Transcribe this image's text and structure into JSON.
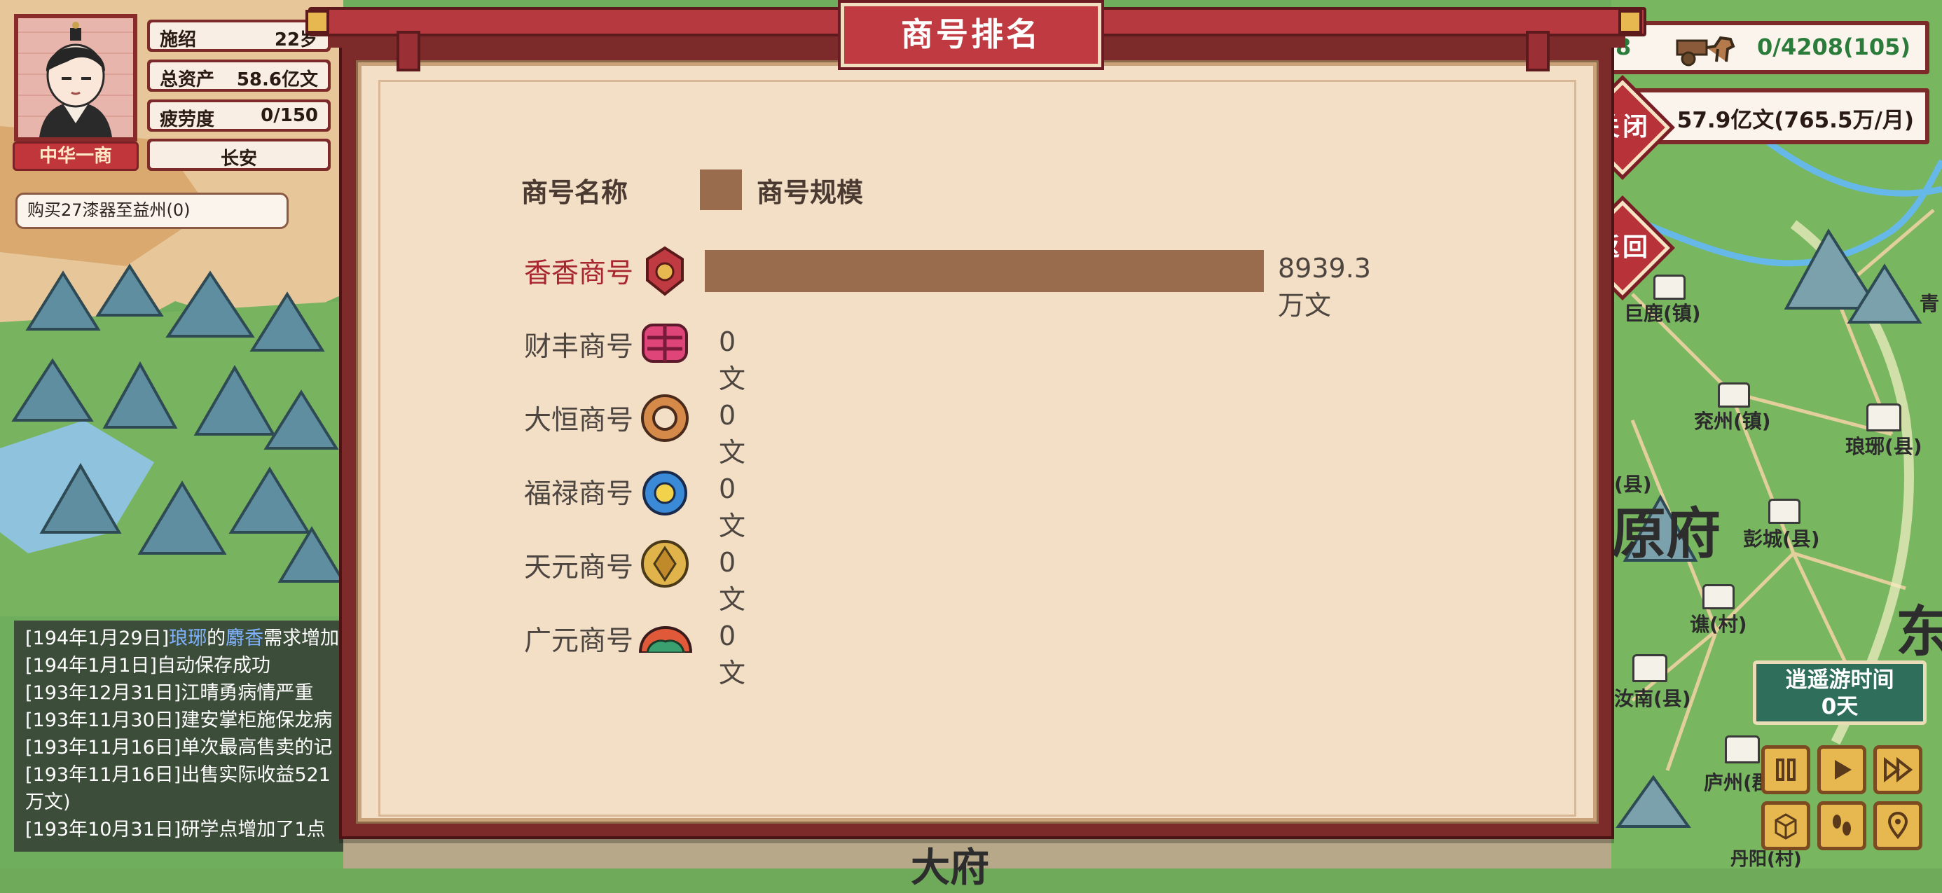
{
  "player": {
    "stats": [
      {
        "label": "施绍",
        "value": "22岁"
      },
      {
        "label": "总资产",
        "value": "58.6亿文"
      },
      {
        "label": "疲劳度",
        "value": "0/150"
      }
    ],
    "location": "长安",
    "title_badge": "中华一商",
    "task": "购买27漆器至益州(0)"
  },
  "log": [
    {
      "date": "[194年1月29日]",
      "parts": [
        "琅琊",
        "的",
        "麝香",
        "需求增加"
      ]
    },
    {
      "text": "[194年1月1日]自动保存成功"
    },
    {
      "text": "[193年12月31日]江晴勇病情严重"
    },
    {
      "text": "[193年11月30日]建安掌柜施保龙病"
    },
    {
      "text": "[193年11月16日]单次最高售卖的记"
    },
    {
      "text": "[193年11月16日]出售实际收益521"
    },
    {
      "text": "万文)"
    },
    {
      "text": "[193年10月31日]研学点增加了1点"
    }
  ],
  "top_right": {
    "cart_count": "0/4208(105)",
    "income": "57.9亿文(765.5万/月)",
    "partial_left": "8"
  },
  "buttons": {
    "close": "关闭",
    "back": "返回"
  },
  "dialog": {
    "title": "商号排名",
    "header_name": "商号名称",
    "header_scale": "商号规模",
    "legend_color": "#9a6c4e"
  },
  "chart_data": {
    "type": "bar",
    "orientation": "horizontal",
    "categories": [
      "香香商号",
      "财丰商号",
      "大恒商号",
      "福禄商号",
      "天元商号",
      "广元商号"
    ],
    "values": [
      8939.3,
      0,
      0,
      0,
      0,
      0
    ],
    "value_labels": [
      "8939.3万文",
      "0文",
      "0文",
      "0文",
      "0文",
      "0文"
    ],
    "unit": "万文",
    "xlim": [
      0,
      8939.3
    ],
    "highlight_category": "香香商号",
    "highlight_color": "#a8262e",
    "bar_color": "#9a6c4e"
  },
  "rank_icons": [
    "banner-emblem-icon",
    "ribbon-knot-icon",
    "copper-ring-icon",
    "blue-gem-icon",
    "golden-coin-icon",
    "mountain-cloud-icon"
  ],
  "time_panel": {
    "label": "逍遥游时间",
    "value": "0天"
  },
  "map_labels": [
    {
      "text": "巨鹿(镇)"
    },
    {
      "text": "兖州(镇)"
    },
    {
      "text": "琅琊(县)"
    },
    {
      "text": "(县)"
    },
    {
      "text": "彭城(县)"
    },
    {
      "text": "谯(村)"
    },
    {
      "text": "汝南(县)"
    },
    {
      "text": "庐州(郡"
    },
    {
      "text": "原府"
    },
    {
      "text": "东"
    },
    {
      "text": "青"
    },
    {
      "text": "大府"
    },
    {
      "text": "丹阳(村)"
    }
  ]
}
